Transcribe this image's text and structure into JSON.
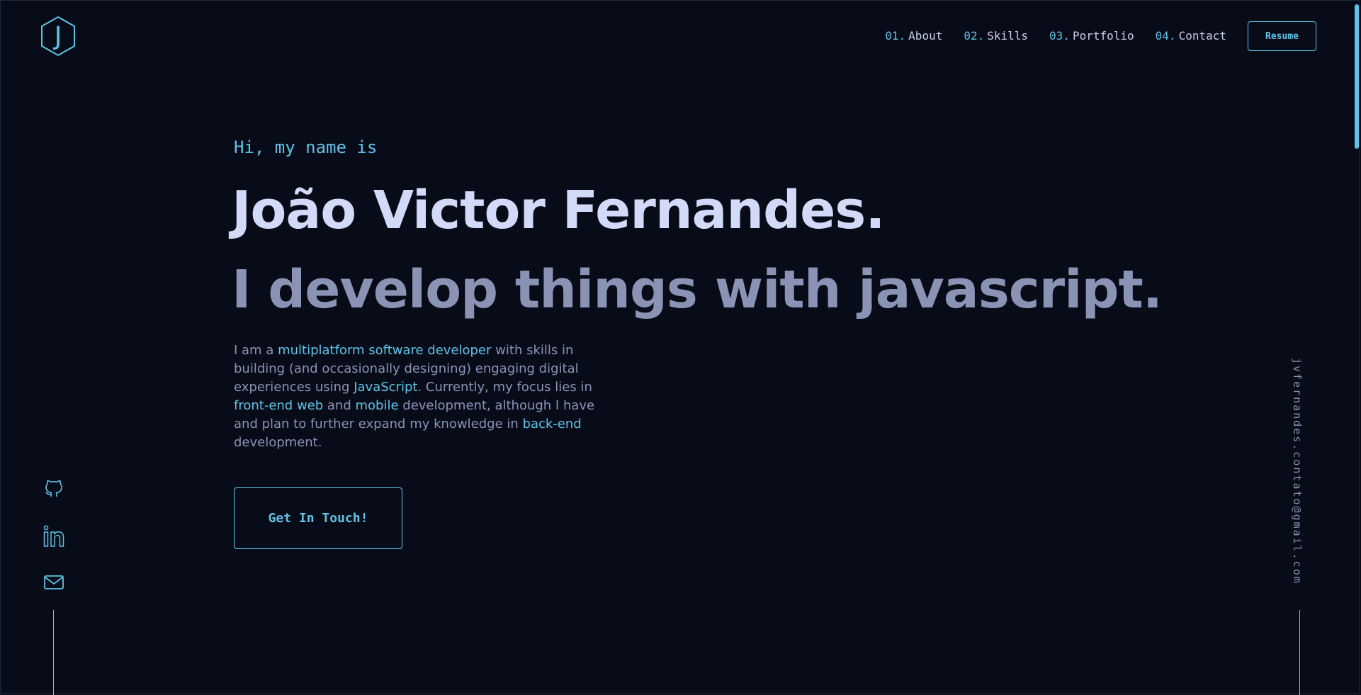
{
  "header": {
    "logo_letter": "J",
    "nav": [
      {
        "num": "01.",
        "label": "About"
      },
      {
        "num": "02.",
        "label": "Skills"
      },
      {
        "num": "03.",
        "label": "Portfolio"
      },
      {
        "num": "04.",
        "label": "Contact"
      }
    ],
    "resume_label": "Resume"
  },
  "hero": {
    "greeting": "Hi, my name is",
    "name": "João Victor Fernandes.",
    "tagline": "I develop things with javascript.",
    "bio": {
      "t1": "I am a ",
      "h1": "multiplatform software developer",
      "t2": " with skills in building (and occasionally designing) engaging digital experiences using ",
      "h2": "JavaScript",
      "t3": ". Currently, my focus lies in ",
      "h3": "front-end web",
      "t4": " and ",
      "h4": "mobile",
      "t5": " development, although I have and plan to further expand my knowledge in ",
      "h5": "back-end",
      "t6": " development."
    },
    "cta_label": "Get In Touch!"
  },
  "sidebar_right": {
    "email": "jvfernandes.contato@gmail.com"
  },
  "social_icons": [
    "github-icon",
    "linkedin-icon",
    "mail-icon"
  ],
  "colors": {
    "background": "#080c18",
    "accent": "#5ec4e6",
    "heading": "#d3daf7",
    "text": "#8b93b5"
  }
}
